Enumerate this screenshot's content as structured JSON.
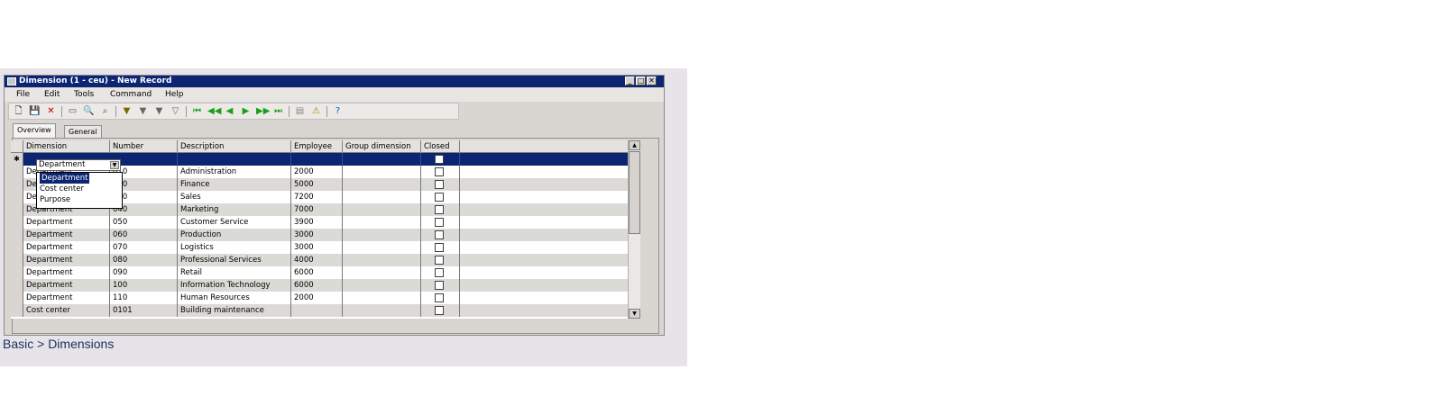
{
  "window": {
    "title": "Dimension (1 - ceu) - New Record",
    "controls": [
      "_",
      "□",
      "✕"
    ]
  },
  "menu": [
    "File",
    "Edit",
    "Tools",
    "Command",
    "Help"
  ],
  "tabs": [
    {
      "label": "Overview",
      "active": true
    },
    {
      "label": "General",
      "active": false
    }
  ],
  "grid": {
    "columns": [
      "Dimension",
      "Number",
      "Description",
      "Employee",
      "Group dimension",
      "Closed"
    ],
    "new_row": {
      "dimension": "Department",
      "number": "",
      "description": "",
      "employee": "",
      "group": ""
    },
    "rows": [
      {
        "dimension": "Department",
        "number": "010",
        "description": "Administration",
        "employee": "2000"
      },
      {
        "dimension": "Department",
        "number": "020",
        "description": "Finance",
        "employee": "5000"
      },
      {
        "dimension": "Department",
        "number": "030",
        "description": "Sales",
        "employee": "7200"
      },
      {
        "dimension": "Department",
        "number": "040",
        "description": "Marketing",
        "employee": "7000"
      },
      {
        "dimension": "Department",
        "number": "050",
        "description": "Customer Service",
        "employee": "3900"
      },
      {
        "dimension": "Department",
        "number": "060",
        "description": "Production",
        "employee": "3000"
      },
      {
        "dimension": "Department",
        "number": "070",
        "description": "Logistics",
        "employee": "3000"
      },
      {
        "dimension": "Department",
        "number": "080",
        "description": "Professional Services",
        "employee": "4000"
      },
      {
        "dimension": "Department",
        "number": "090",
        "description": "Retail",
        "employee": "6000"
      },
      {
        "dimension": "Department",
        "number": "100",
        "description": "Information Technology",
        "employee": "6000"
      },
      {
        "dimension": "Department",
        "number": "110",
        "description": "Human Resources",
        "employee": "2000"
      },
      {
        "dimension": "Cost center",
        "number": "0101",
        "description": "Building maintenance",
        "employee": ""
      }
    ]
  },
  "dropdown": {
    "options": [
      "Department",
      "Cost center",
      "Purpose"
    ],
    "selected": "Department"
  },
  "caption": "Basic > Dimensions",
  "colors": {
    "titlebar": "#0b2573",
    "selection": "#0b2573",
    "caption": "#1f2f5a"
  }
}
